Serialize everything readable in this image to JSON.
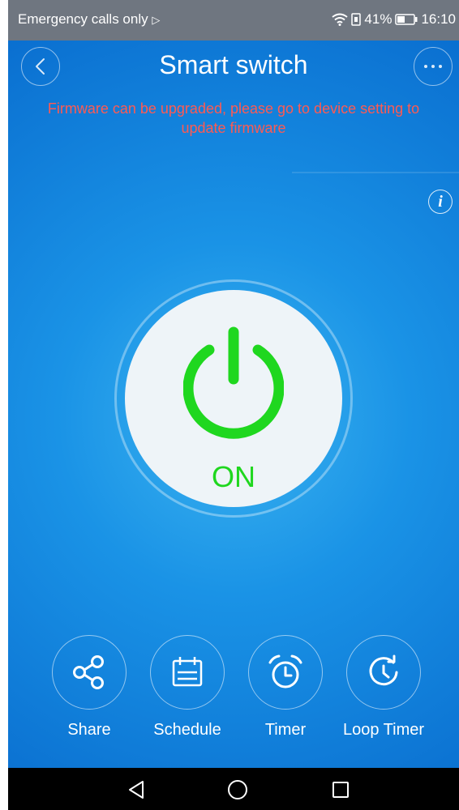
{
  "status_bar": {
    "carrier_text": "Emergency calls only",
    "battery_percent": "41%",
    "time": "16:10"
  },
  "header": {
    "title": "Smart switch",
    "back_icon": "chevron-left-icon",
    "more_icon": "more-dots-icon"
  },
  "notice": {
    "line1": "Firmware can be upgraded, please go to device setting to",
    "line2": "update firmware",
    "color": "#ff5a52"
  },
  "power": {
    "state_label": "ON",
    "on_color": "#1fd71f"
  },
  "actions": [
    {
      "label": "Share",
      "icon": "share-icon"
    },
    {
      "label": "Schedule",
      "icon": "calendar-icon"
    },
    {
      "label": "Timer",
      "icon": "alarm-clock-icon"
    },
    {
      "label": "Loop Timer",
      "icon": "loop-clock-icon"
    }
  ],
  "colors": {
    "background": "#1a93e6",
    "status_bar": "#6f7680"
  }
}
